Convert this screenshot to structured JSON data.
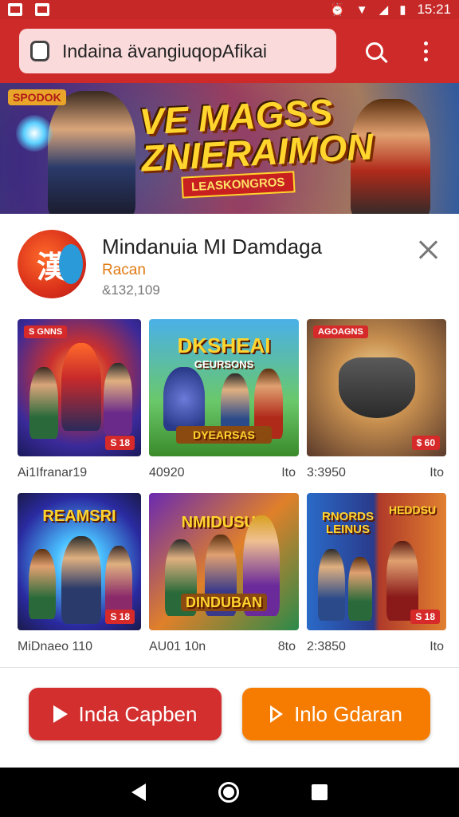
{
  "status_bar": {
    "time": "15:21",
    "icons": [
      "notification-icon",
      "image-icon",
      "alarm-icon",
      "wifi-icon",
      "signal-icon",
      "battery-icon"
    ]
  },
  "toolbar": {
    "url_text": "Indaina ävangiuqopAfikai",
    "icons": [
      "lock-icon",
      "search-icon",
      "more-vert-icon"
    ]
  },
  "banner": {
    "tag": "SPODOK",
    "title_line1": "VE MAGSS",
    "title_line2": "ZNIERAIMON",
    "ribbon": "LEASKONGROS"
  },
  "app": {
    "name": "Mindanuia MI Damdaga",
    "developer": "Racan",
    "meta": "&132,109"
  },
  "tiles": [
    {
      "badge_tl": "S GNNS",
      "badge_br": "S 18",
      "caption_left": "Ai1Ifranar19",
      "caption_right": ""
    },
    {
      "title": "DKSHEAI",
      "subtitle": "GEURSONS",
      "ribbon": "DYEARSAS",
      "caption_left": "40920",
      "caption_right": "Ito"
    },
    {
      "badge_tl": "AGOAGNS",
      "badge_br": "$ 60",
      "caption_left": "3:3950",
      "caption_right": "Ito"
    },
    {
      "title": "REAMSRI",
      "badge_br": "S 18",
      "caption_left": "MiDnaeo 110",
      "caption_right": ""
    },
    {
      "title": "NMIDUSUE",
      "ribbon": "DINDUBAN",
      "caption_left": "AU01 10n",
      "caption_right": "8to"
    },
    {
      "title": "RNORDS LEINUS",
      "title2": "HEDDSU",
      "badge_br": "S 18",
      "caption_left": "2:3850",
      "caption_right": "Ito"
    }
  ],
  "buttons": {
    "primary": "Inda Capben",
    "secondary": "Inlo Gdaran"
  },
  "colors": {
    "brand_red": "#cf2a2a",
    "accent_orange": "#f57c00"
  }
}
